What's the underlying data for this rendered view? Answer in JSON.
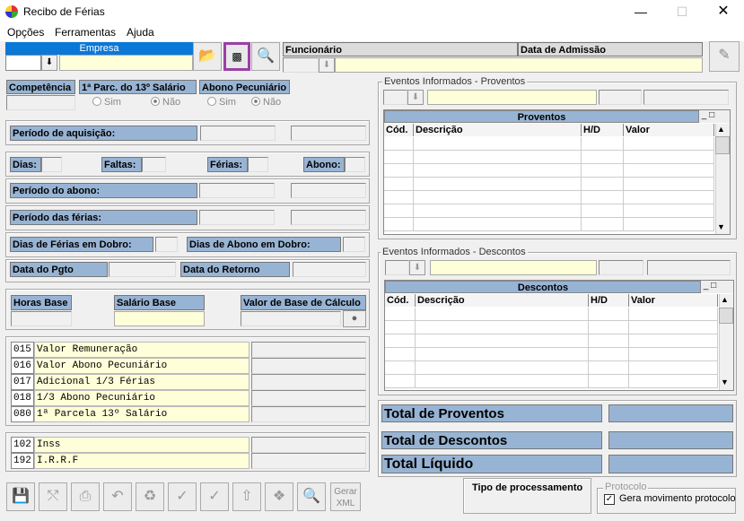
{
  "window": {
    "title": "Recibo de Férias"
  },
  "menu": [
    "Opções",
    "Ferramentas",
    "Ajuda"
  ],
  "header": {
    "empresa_label": "Empresa",
    "funcionario_label": "Funcionário",
    "admissao_label": "Data de Admissão"
  },
  "fields": {
    "competencia": "Competência",
    "parc13": "1ª Parc. do 13º Salário",
    "abono_pec": "Abono Pecuniário",
    "sim": "Sim",
    "nao": "Não",
    "periodo_aquisicao": "Período de aquisição:",
    "dias": "Dias:",
    "faltas": "Faltas:",
    "ferias": "Férias:",
    "abono": "Abono:",
    "periodo_abono": "Período do abono:",
    "periodo_ferias": "Período das férias:",
    "dias_ferias_dobro": "Dias de Férias em Dobro:",
    "dias_abono_dobro": "Dias de Abono em Dobro:",
    "data_pgto": "Data do Pgto",
    "data_retorno": "Data do Retorno",
    "horas_base": "Horas Base",
    "salario_base": "Salário Base",
    "valor_base": "Valor de Base de Cálculo"
  },
  "rubricas": [
    {
      "code": "015",
      "desc": "Valor Remuneração"
    },
    {
      "code": "016",
      "desc": "Valor Abono Pecuniário"
    },
    {
      "code": "017",
      "desc": "Adicional 1/3 Férias"
    },
    {
      "code": "018",
      "desc": "1/3 Abono Pecuniário"
    },
    {
      "code": "080",
      "desc": "1ª Parcela 13º Salário"
    }
  ],
  "descontos_rub": [
    {
      "code": "102",
      "desc": "Inss"
    },
    {
      "code": "192",
      "desc": "I.R.R.F"
    }
  ],
  "proventos": {
    "section": "Eventos Informados - Proventos",
    "title": "Proventos",
    "cols": [
      "Cód.",
      "Descrição",
      "H/D",
      "Valor"
    ]
  },
  "descontos": {
    "section": "Eventos Informados - Descontos",
    "title": "Descontos",
    "cols": [
      "Cód.",
      "Descrição",
      "H/D",
      "Valor"
    ]
  },
  "totals": {
    "proventos": "Total de Proventos",
    "descontos": "Total de Descontos",
    "liquido": "Total Líquido"
  },
  "bottom": {
    "tipo_proc": "Tipo de processamento",
    "protocolo": "Protocolo",
    "gera_mov": "Gera movimento protocolo",
    "gerar_xml": "Gerar XML"
  }
}
